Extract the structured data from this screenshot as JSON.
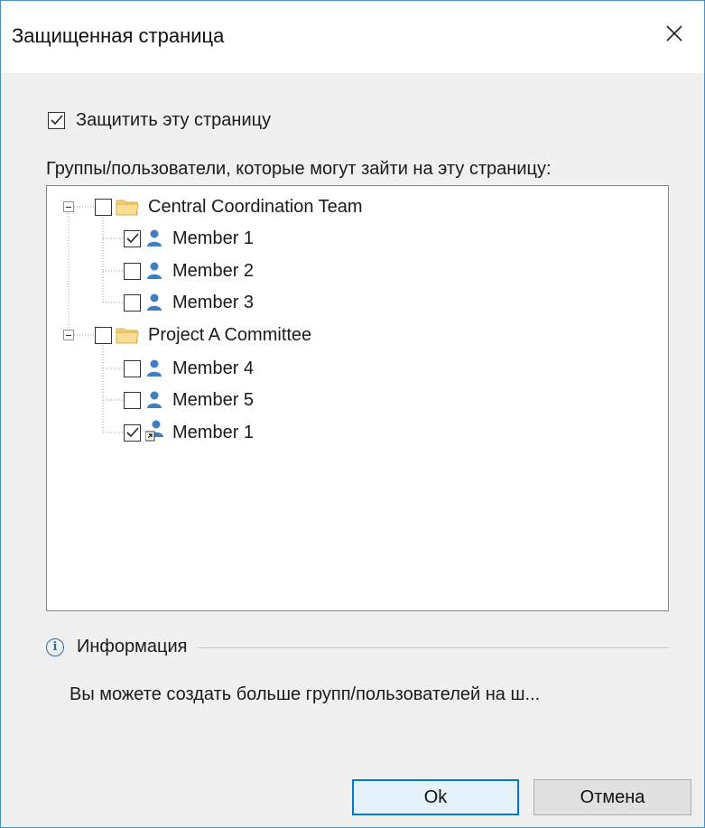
{
  "dialog": {
    "title": "Защищенная страница",
    "protect_label": "Защитить эту страницу",
    "protect_checked": true,
    "groups_label": "Группы/пользователи, которые могут зайти на эту страницу:",
    "tree": [
      {
        "label": "Central Coordination Team",
        "checked": false,
        "expanded": true,
        "icon": "folder-icon",
        "children": [
          {
            "label": "Member 1",
            "checked": true,
            "icon": "user-icon"
          },
          {
            "label": "Member 2",
            "checked": false,
            "icon": "user-icon"
          },
          {
            "label": "Member 3",
            "checked": false,
            "icon": "user-icon"
          }
        ]
      },
      {
        "label": "Project A Committee",
        "checked": false,
        "expanded": true,
        "icon": "folder-icon",
        "children": [
          {
            "label": "Member 4",
            "checked": false,
            "icon": "user-icon"
          },
          {
            "label": "Member 5",
            "checked": false,
            "icon": "user-icon"
          },
          {
            "label": "Member 1",
            "checked": true,
            "icon": "user-shortcut-icon"
          }
        ]
      }
    ],
    "info": {
      "title": "Информация",
      "text": "Вы можете создать больше групп/пользователей на ш..."
    },
    "buttons": {
      "ok": "Ok",
      "cancel": "Отмена"
    }
  },
  "colors": {
    "accent": "#0078d7",
    "user_icon": "#3f7fc0",
    "folder": "#e9c46a",
    "window_border": "#4a90c8",
    "client_bg": "#f0f0f0"
  }
}
